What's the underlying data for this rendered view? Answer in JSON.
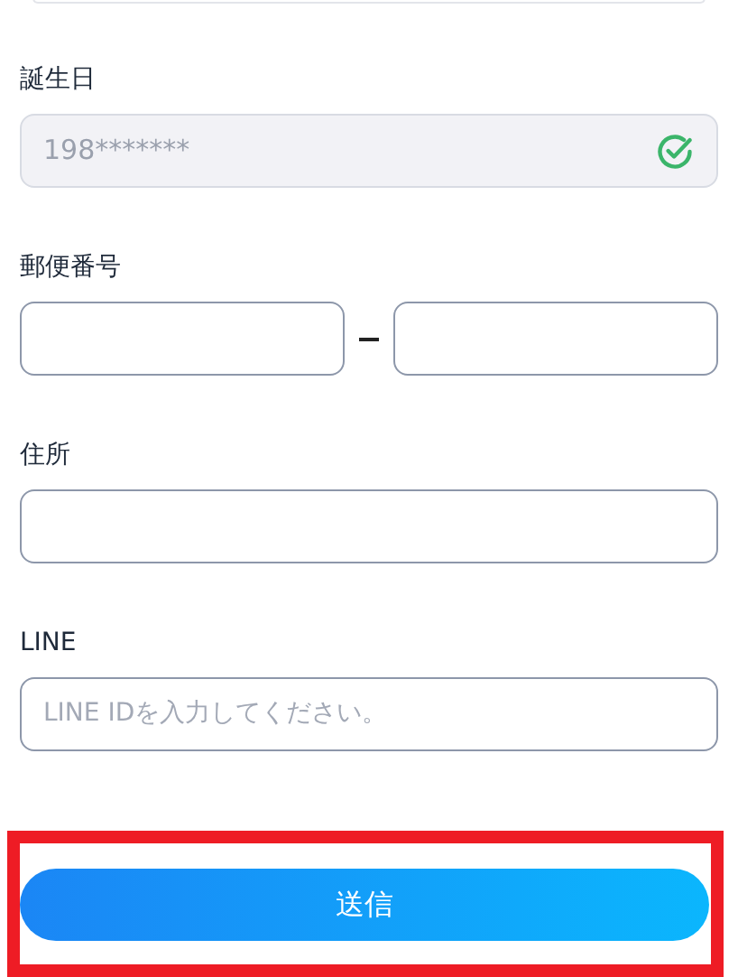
{
  "fields": [
    {
      "kind": "text",
      "label": "誕生日",
      "value": "198*******",
      "disabled": true,
      "verified": true
    },
    {
      "kind": "postal",
      "label": "郵便番号"
    },
    {
      "kind": "text",
      "label": "住所",
      "disabled": false,
      "verified": false
    },
    {
      "kind": "text",
      "label": "LINE",
      "placeholder": "LINE IDを入力してください。",
      "disabled": false,
      "verified": false
    }
  ],
  "submit": {
    "label": "送信",
    "highlighted": true
  }
}
